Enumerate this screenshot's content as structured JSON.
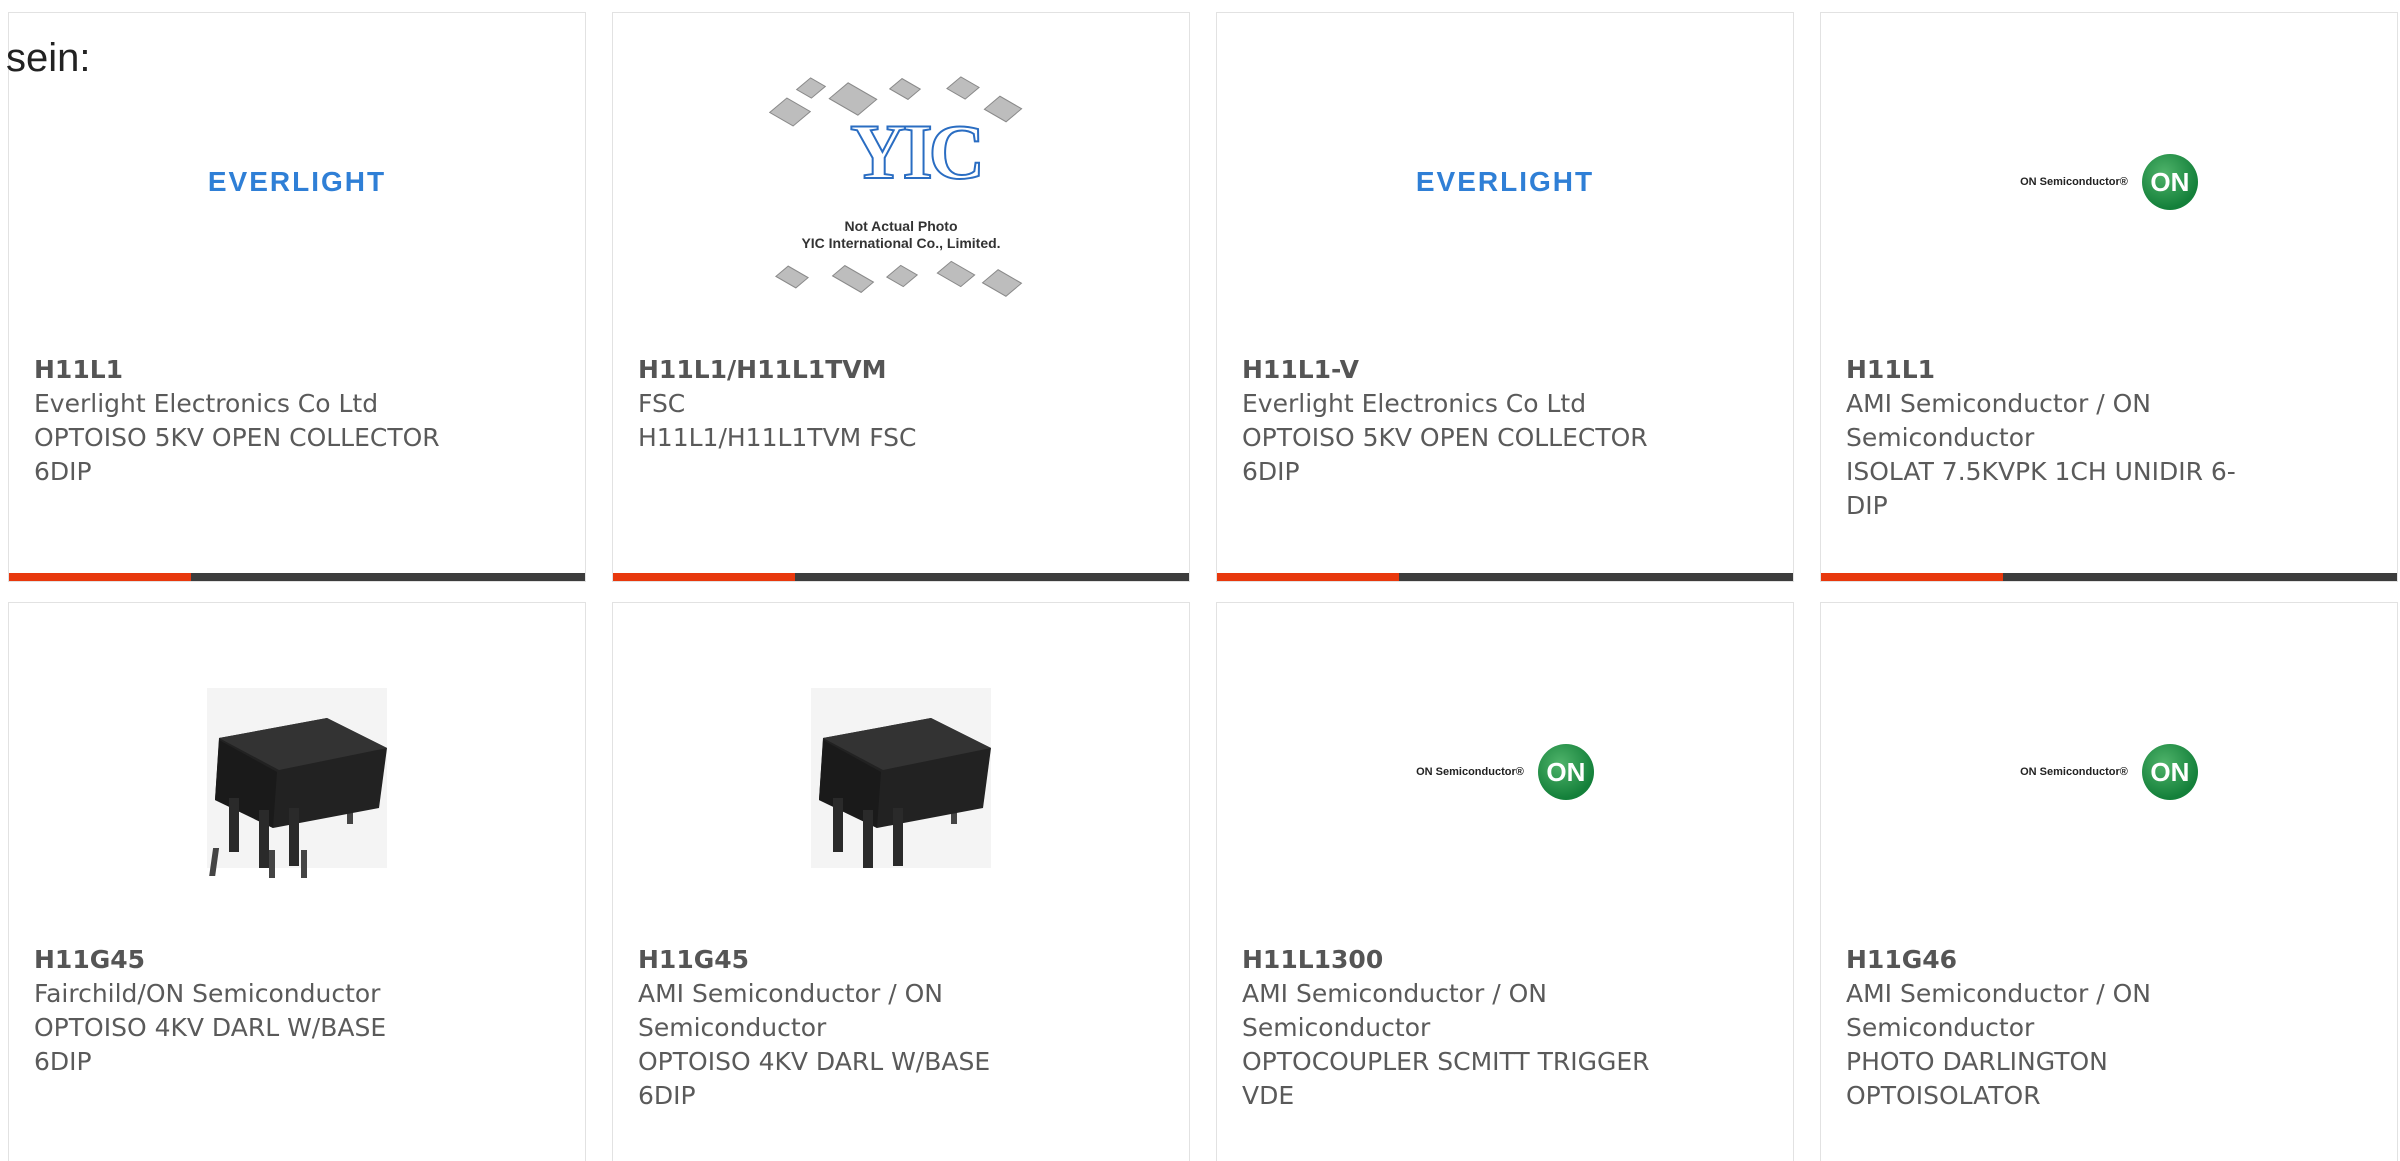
{
  "intro": {
    "text": "sein:"
  },
  "colors": {
    "accent": "#e8380d",
    "bar": "#3c3c3c",
    "everlight_blue": "#2f7fd6",
    "on_green": "#1a8a3f"
  },
  "products": [
    {
      "part_number": "H11L1",
      "manufacturer": "Everlight Electronics Co Ltd",
      "description_lines": [
        "OPTOISO 5KV OPEN COLLECTOR",
        "6DIP"
      ],
      "image": "everlight-logo",
      "logo_text": "EVERLIGHT"
    },
    {
      "part_number": "H11L1/H11L1TVM",
      "manufacturer": "FSC",
      "description_lines": [
        "H11L1/H11L1TVM FSC"
      ],
      "image": "yic-placeholder",
      "logo_text": "YIC",
      "caption_lines": [
        "Not Actual Photo",
        "YIC International Co., Limited."
      ]
    },
    {
      "part_number": "H11L1-V",
      "manufacturer": "Everlight Electronics Co Ltd",
      "description_lines": [
        "OPTOISO 5KV OPEN COLLECTOR",
        "6DIP"
      ],
      "image": "everlight-logo",
      "logo_text": "EVERLIGHT"
    },
    {
      "part_number": "H11L1",
      "manufacturer_lines": [
        "AMI Semiconductor / ON",
        "Semiconductor"
      ],
      "description_lines": [
        "ISOLAT 7.5KVPK 1CH UNIDIR 6-",
        "DIP"
      ],
      "image": "on-semi-logo",
      "logo_text": "ON Semiconductor®",
      "badge_text": "ON"
    },
    {
      "part_number": "H11G45",
      "manufacturer": "Fairchild/ON Semiconductor",
      "description_lines": [
        "OPTOISO 4KV DARL W/BASE",
        "6DIP"
      ],
      "image": "dip6-chip-photo"
    },
    {
      "part_number": "H11G45",
      "manufacturer_lines": [
        "AMI Semiconductor / ON",
        "Semiconductor"
      ],
      "description_lines": [
        "OPTOISO 4KV DARL W/BASE",
        "6DIP"
      ],
      "image": "dip6-chip-photo"
    },
    {
      "part_number": "H11L1300",
      "manufacturer_lines": [
        "AMI Semiconductor / ON",
        "Semiconductor"
      ],
      "description_lines": [
        "OPTOCOUPLER SCMITT TRIGGER",
        "VDE"
      ],
      "image": "on-semi-logo",
      "logo_text": "ON Semiconductor®",
      "badge_text": "ON"
    },
    {
      "part_number": "H11G46",
      "manufacturer_lines": [
        "AMI Semiconductor / ON",
        "Semiconductor"
      ],
      "description_lines": [
        "PHOTO DARLINGTON",
        "OPTOISOLATOR"
      ],
      "image": "on-semi-logo",
      "logo_text": "ON Semiconductor®",
      "badge_text": "ON"
    }
  ]
}
